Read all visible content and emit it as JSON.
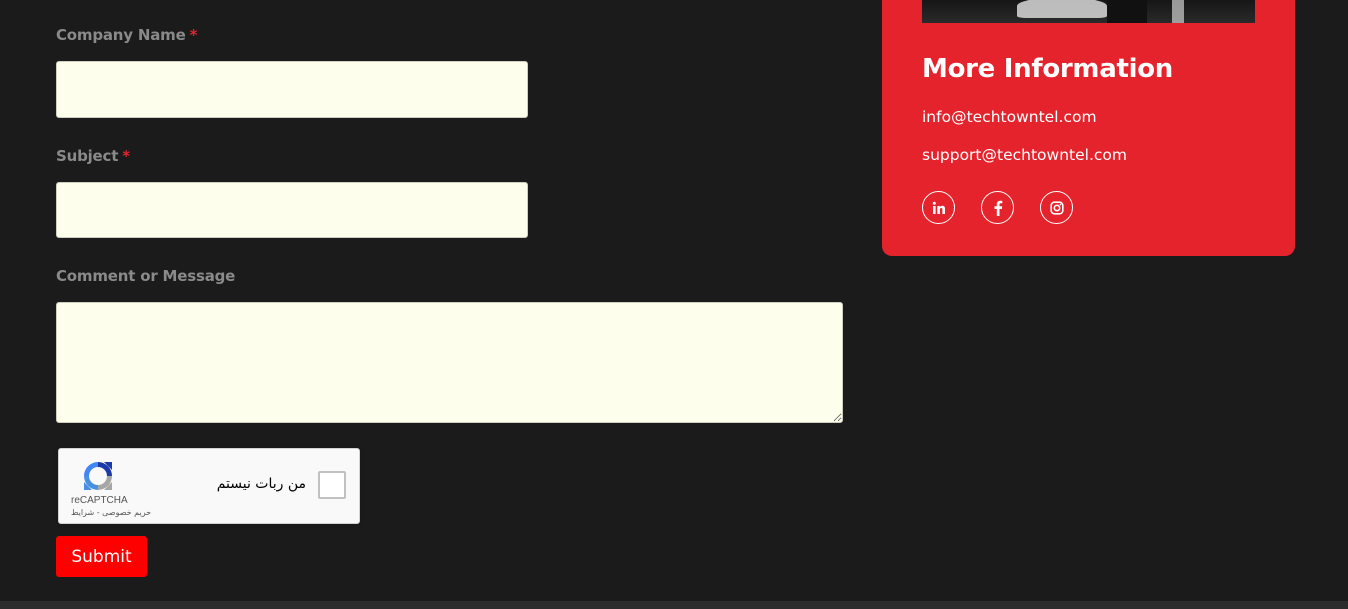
{
  "form": {
    "company_label": "Company Name",
    "subject_label": "Subject",
    "comment_label": "Comment or Message",
    "required_marker": "*",
    "company_value": "",
    "subject_value": "",
    "comment_value": "",
    "submit_label": "Submit"
  },
  "captcha": {
    "checkbox_text": "من ربات نیستم",
    "brand": "reCAPTCHA",
    "links": "حریم خصوصی - شرایط"
  },
  "info_card": {
    "title": "More Information",
    "emails": [
      "info@techtowntel.com",
      "support@techtowntel.com"
    ],
    "social_icons": [
      "linkedin-icon",
      "facebook-icon",
      "instagram-icon"
    ]
  },
  "colors": {
    "background": "#1b1b1b",
    "card": "#e5232c",
    "submit": "#ff0000",
    "field": "#fdfeeb",
    "required": "#e32530"
  }
}
